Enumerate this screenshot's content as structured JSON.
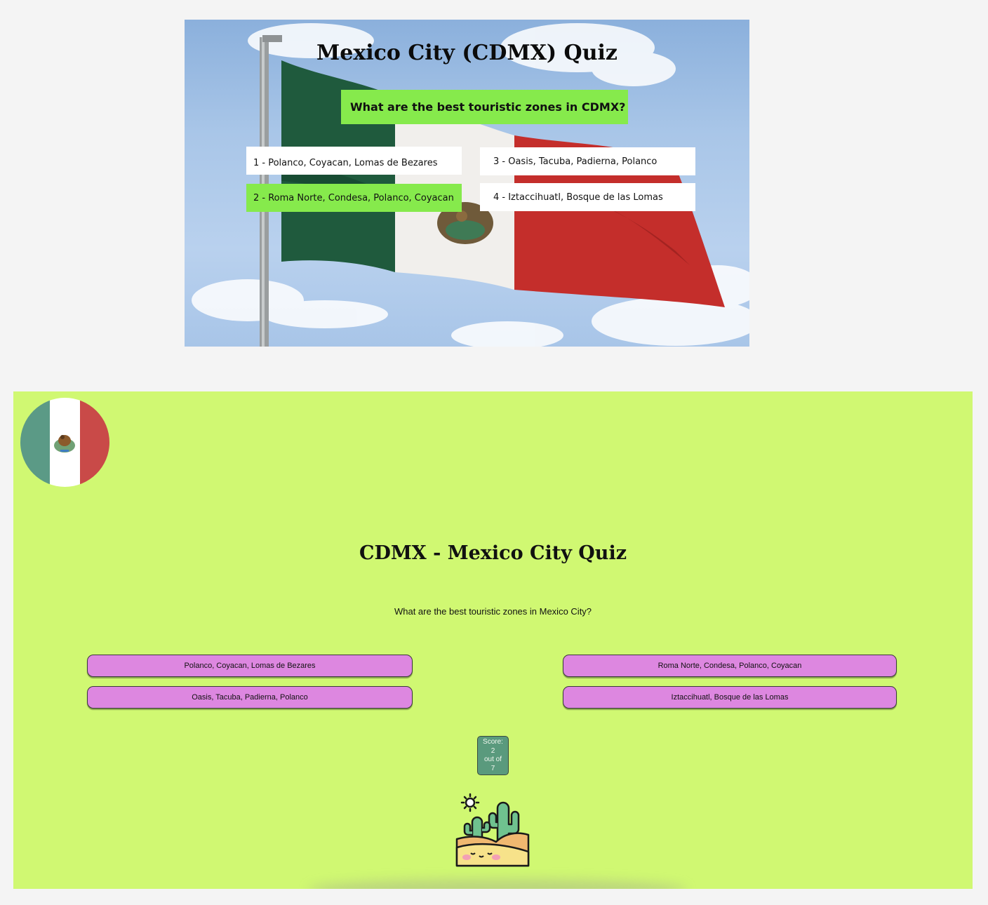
{
  "mockup": {
    "title": "Mexico City (CDMX) Quiz",
    "question": "What are the best touristic zones in CDMX?",
    "options": [
      "1 - Polanco, Coyacan, Lomas de Bezares",
      "2 - Roma Norte, Condesa, Polanco, Coyacan",
      "3 - Oasis, Tacuba, Padierna, Polanco",
      "4 - Iztaccihuatl, Bosque de las Lomas"
    ]
  },
  "app": {
    "title": "CDMX - Mexico City Quiz",
    "question": "What are the best touristic zones in Mexico City?",
    "answers": [
      "Polanco, Coyacan, Lomas de Bezares",
      "Roma Norte, Condesa, Polanco, Coyacan",
      "Oasis, Tacuba, Padierna, Polanco",
      "Iztaccihuatl, Bosque de las Lomas"
    ],
    "score": {
      "label": "Score:",
      "value": "2",
      "out_of": "out of",
      "total": "7"
    }
  },
  "colors": {
    "app_background": "#d0f872",
    "answer_button": "#dd87e0",
    "score_box": "#5a9a7d",
    "mockup_highlight": "#86ea4c",
    "flag_green": "#5b9a86",
    "flag_red": "#c94a48"
  },
  "icons": [
    "mexico-flag-photo",
    "mexico-flag-badge",
    "cactus-desert-illustration"
  ]
}
